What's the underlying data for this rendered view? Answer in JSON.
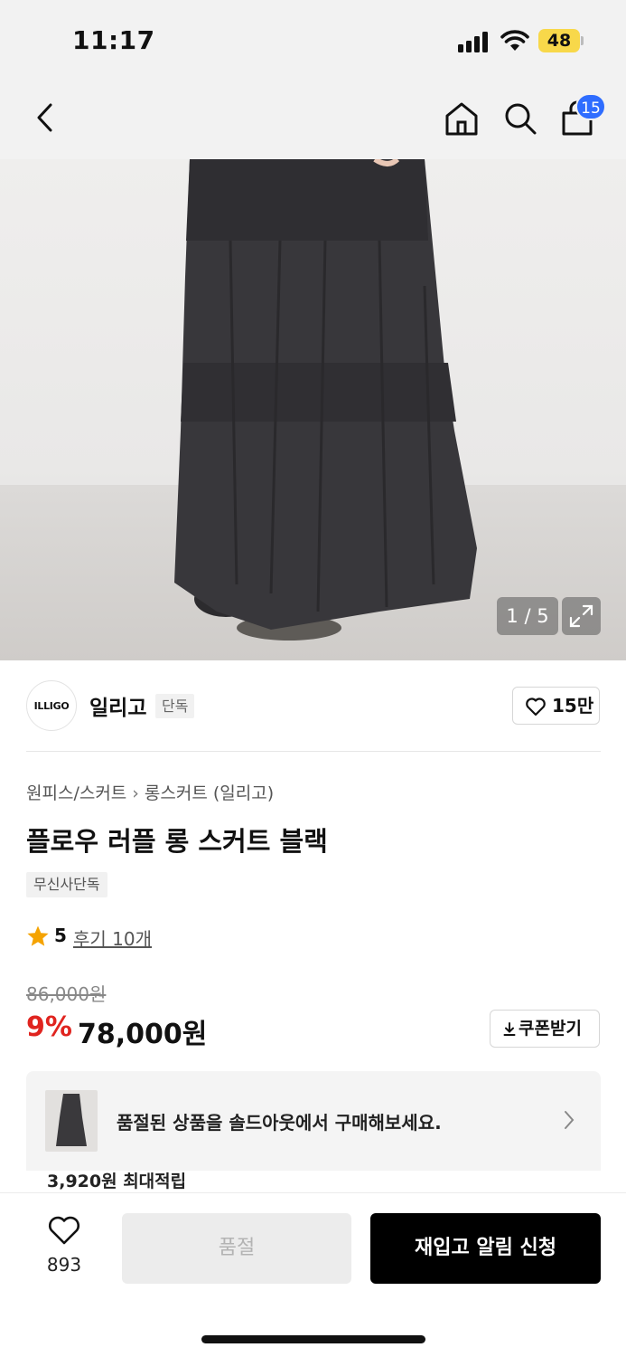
{
  "status_bar": {
    "time": "11:17",
    "battery": "48",
    "battery_color": "#f8d84a"
  },
  "nav": {
    "back_icon": "chevron-left-icon",
    "home_icon": "home-icon",
    "search_icon": "search-icon",
    "cart_icon": "shopping-bag-icon",
    "cart_count": "15",
    "badge_color": "#2f6dff"
  },
  "gallery": {
    "counter": "1 / 5",
    "expand_icon": "expand-icon"
  },
  "brand": {
    "logo_text": "ILLIGO",
    "name": "일리고",
    "tag": "단독",
    "likes": "15만"
  },
  "product": {
    "breadcrumb": [
      "원피스/스커트",
      "롱스커트 (일리고)"
    ],
    "title": "플로우 러플 롱 스커트 블랙",
    "exclusive_tag": "무신사단독",
    "rating": "5",
    "reviews": "후기 10개",
    "original_price": "86,000원",
    "discount": "9%",
    "discount_color": "#e0241f",
    "price": "78,000원",
    "coupon_label": "쿠폰받기"
  },
  "soldout_banner": {
    "text": "품절된 상품을 솔드아웃에서 구매해보세요.",
    "points_text": "3,920원 최대적립"
  },
  "bottom_bar": {
    "wish_count": "893",
    "soldout_label": "품절",
    "notify_label": "재입고 알림 신청"
  }
}
